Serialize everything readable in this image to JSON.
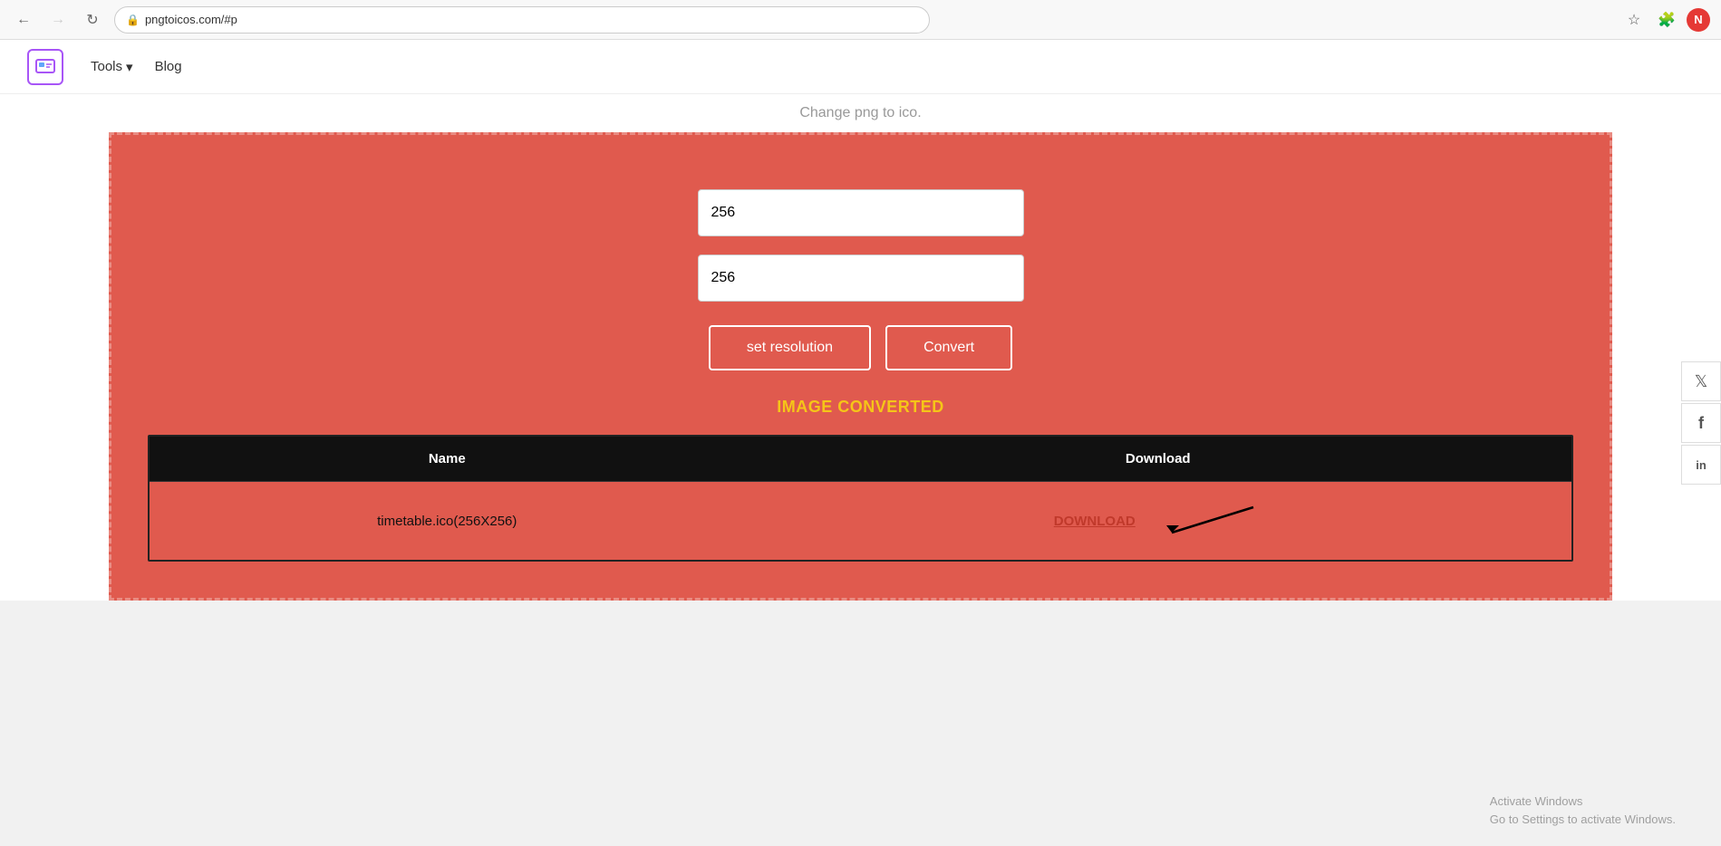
{
  "browser": {
    "url": "pngtoicos.com/#p",
    "back_disabled": false,
    "forward_disabled": true,
    "avatar_letter": "N"
  },
  "nav": {
    "tools_label": "Tools",
    "blog_label": "Blog",
    "tools_dropdown_icon": "▾"
  },
  "page": {
    "subtitle": "Change png to ico."
  },
  "form": {
    "width_value": "256",
    "height_value": "256",
    "set_resolution_label": "set resolution",
    "convert_label": "Convert",
    "status_text": "IMAGE CONVERTED"
  },
  "table": {
    "name_header": "Name",
    "download_header": "Download",
    "row": {
      "filename": "timetable.ico(256X256)",
      "download_label": "DOWNLOAD"
    }
  },
  "social": {
    "twitter_icon": "🐦",
    "facebook_icon": "f",
    "linkedin_icon": "in"
  },
  "activate_windows": {
    "line1": "Activate Windows",
    "line2": "Go to Settings to activate Windows."
  }
}
